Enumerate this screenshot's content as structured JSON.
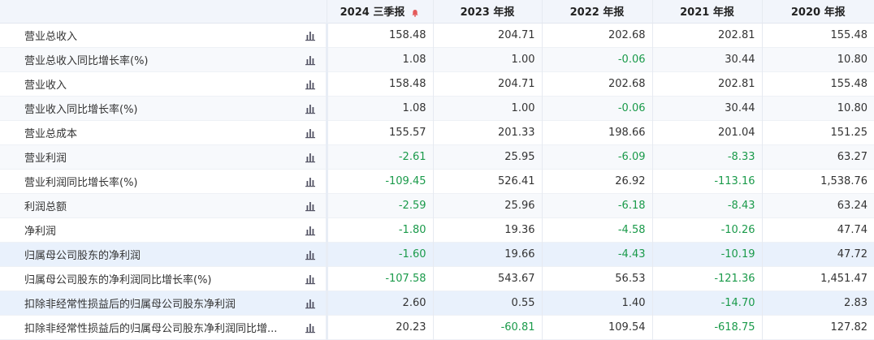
{
  "header": {
    "periods": [
      "2024 三季报",
      "2023 年报",
      "2022 年报",
      "2021 年报",
      "2020 年报"
    ],
    "alert_icon": "bell-icon",
    "alert_color": "#e45a5a"
  },
  "rows": [
    {
      "label": "营业总收入",
      "values": [
        "158.48",
        "204.71",
        "202.68",
        "202.81",
        "155.48"
      ],
      "neg": [
        false,
        false,
        false,
        false,
        false
      ]
    },
    {
      "label": "营业总收入同比增长率(%)",
      "values": [
        "1.08",
        "1.00",
        "-0.06",
        "30.44",
        "10.80"
      ],
      "neg": [
        false,
        false,
        true,
        false,
        false
      ]
    },
    {
      "label": "营业收入",
      "values": [
        "158.48",
        "204.71",
        "202.68",
        "202.81",
        "155.48"
      ],
      "neg": [
        false,
        false,
        false,
        false,
        false
      ]
    },
    {
      "label": "营业收入同比增长率(%)",
      "values": [
        "1.08",
        "1.00",
        "-0.06",
        "30.44",
        "10.80"
      ],
      "neg": [
        false,
        false,
        true,
        false,
        false
      ]
    },
    {
      "label": "营业总成本",
      "values": [
        "155.57",
        "201.33",
        "198.66",
        "201.04",
        "151.25"
      ],
      "neg": [
        false,
        false,
        false,
        false,
        false
      ]
    },
    {
      "label": "营业利润",
      "values": [
        "-2.61",
        "25.95",
        "-6.09",
        "-8.33",
        "63.27"
      ],
      "neg": [
        true,
        false,
        true,
        true,
        false
      ]
    },
    {
      "label": "营业利润同比增长率(%)",
      "values": [
        "-109.45",
        "526.41",
        "26.92",
        "-113.16",
        "1,538.76"
      ],
      "neg": [
        true,
        false,
        false,
        true,
        false
      ]
    },
    {
      "label": "利润总额",
      "values": [
        "-2.59",
        "25.96",
        "-6.18",
        "-8.43",
        "63.24"
      ],
      "neg": [
        true,
        false,
        true,
        true,
        false
      ]
    },
    {
      "label": "净利润",
      "values": [
        "-1.80",
        "19.36",
        "-4.58",
        "-10.26",
        "47.74"
      ],
      "neg": [
        true,
        false,
        true,
        true,
        false
      ]
    },
    {
      "label": "归属母公司股东的净利润",
      "values": [
        "-1.60",
        "19.66",
        "-4.43",
        "-10.19",
        "47.72"
      ],
      "neg": [
        true,
        false,
        true,
        true,
        false
      ]
    },
    {
      "label": "归属母公司股东的净利润同比增长率(%)",
      "values": [
        "-107.58",
        "543.67",
        "56.53",
        "-121.36",
        "1,451.47"
      ],
      "neg": [
        true,
        false,
        false,
        true,
        false
      ]
    },
    {
      "label": "扣除非经常性损益后的归属母公司股东净利润",
      "values": [
        "2.60",
        "0.55",
        "1.40",
        "-14.70",
        "2.83"
      ],
      "neg": [
        false,
        false,
        false,
        true,
        false
      ]
    },
    {
      "label": "扣除非经常性损益后的归属母公司股东净利润同比增...",
      "values": [
        "20.23",
        "-60.81",
        "109.54",
        "-618.75",
        "127.82"
      ],
      "neg": [
        false,
        true,
        false,
        true,
        false
      ]
    }
  ],
  "highlight_rows": [
    9,
    11
  ],
  "colors": {
    "negative": "#1a9a4a",
    "positive": "#333333",
    "chart_icon": "#556"
  }
}
